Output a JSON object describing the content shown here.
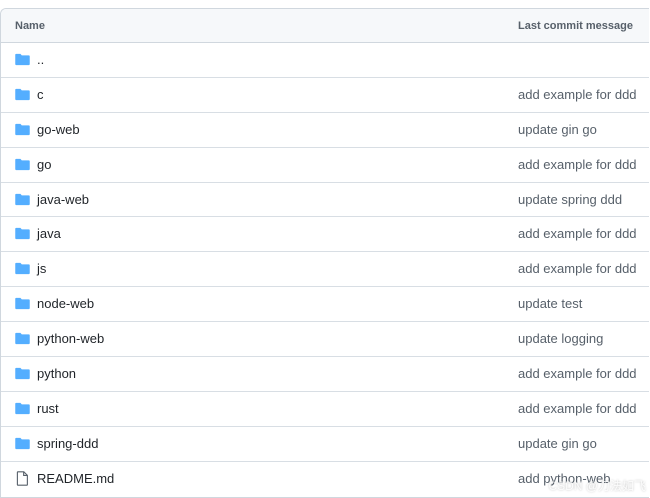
{
  "table": {
    "header": {
      "name_label": "Name",
      "message_label": "Last commit message"
    },
    "rows": [
      {
        "icon": "folder-icon",
        "name": "..",
        "message": ""
      },
      {
        "icon": "folder-icon",
        "name": "c",
        "message": "add example for ddd"
      },
      {
        "icon": "folder-icon",
        "name": "go-web",
        "message": "update gin go"
      },
      {
        "icon": "folder-icon",
        "name": "go",
        "message": "add example for ddd"
      },
      {
        "icon": "folder-icon",
        "name": "java-web",
        "message": "update spring ddd"
      },
      {
        "icon": "folder-icon",
        "name": "java",
        "message": "add example for ddd"
      },
      {
        "icon": "folder-icon",
        "name": "js",
        "message": "add example for ddd"
      },
      {
        "icon": "folder-icon",
        "name": "node-web",
        "message": "update test"
      },
      {
        "icon": "folder-icon",
        "name": "python-web",
        "message": "update logging"
      },
      {
        "icon": "folder-icon",
        "name": "python",
        "message": "add example for ddd"
      },
      {
        "icon": "folder-icon",
        "name": "rust",
        "message": "add example for ddd"
      },
      {
        "icon": "folder-icon",
        "name": "spring-ddd",
        "message": "update gin go"
      },
      {
        "icon": "file-icon",
        "name": "README.md",
        "message": "add python-web"
      }
    ]
  },
  "watermark": "CSDN @刀法如飞",
  "colors": {
    "folder": "#54aeff",
    "file_outline": "#57606a",
    "border": "#d0d7de",
    "header_bg": "#f6f8fa"
  }
}
